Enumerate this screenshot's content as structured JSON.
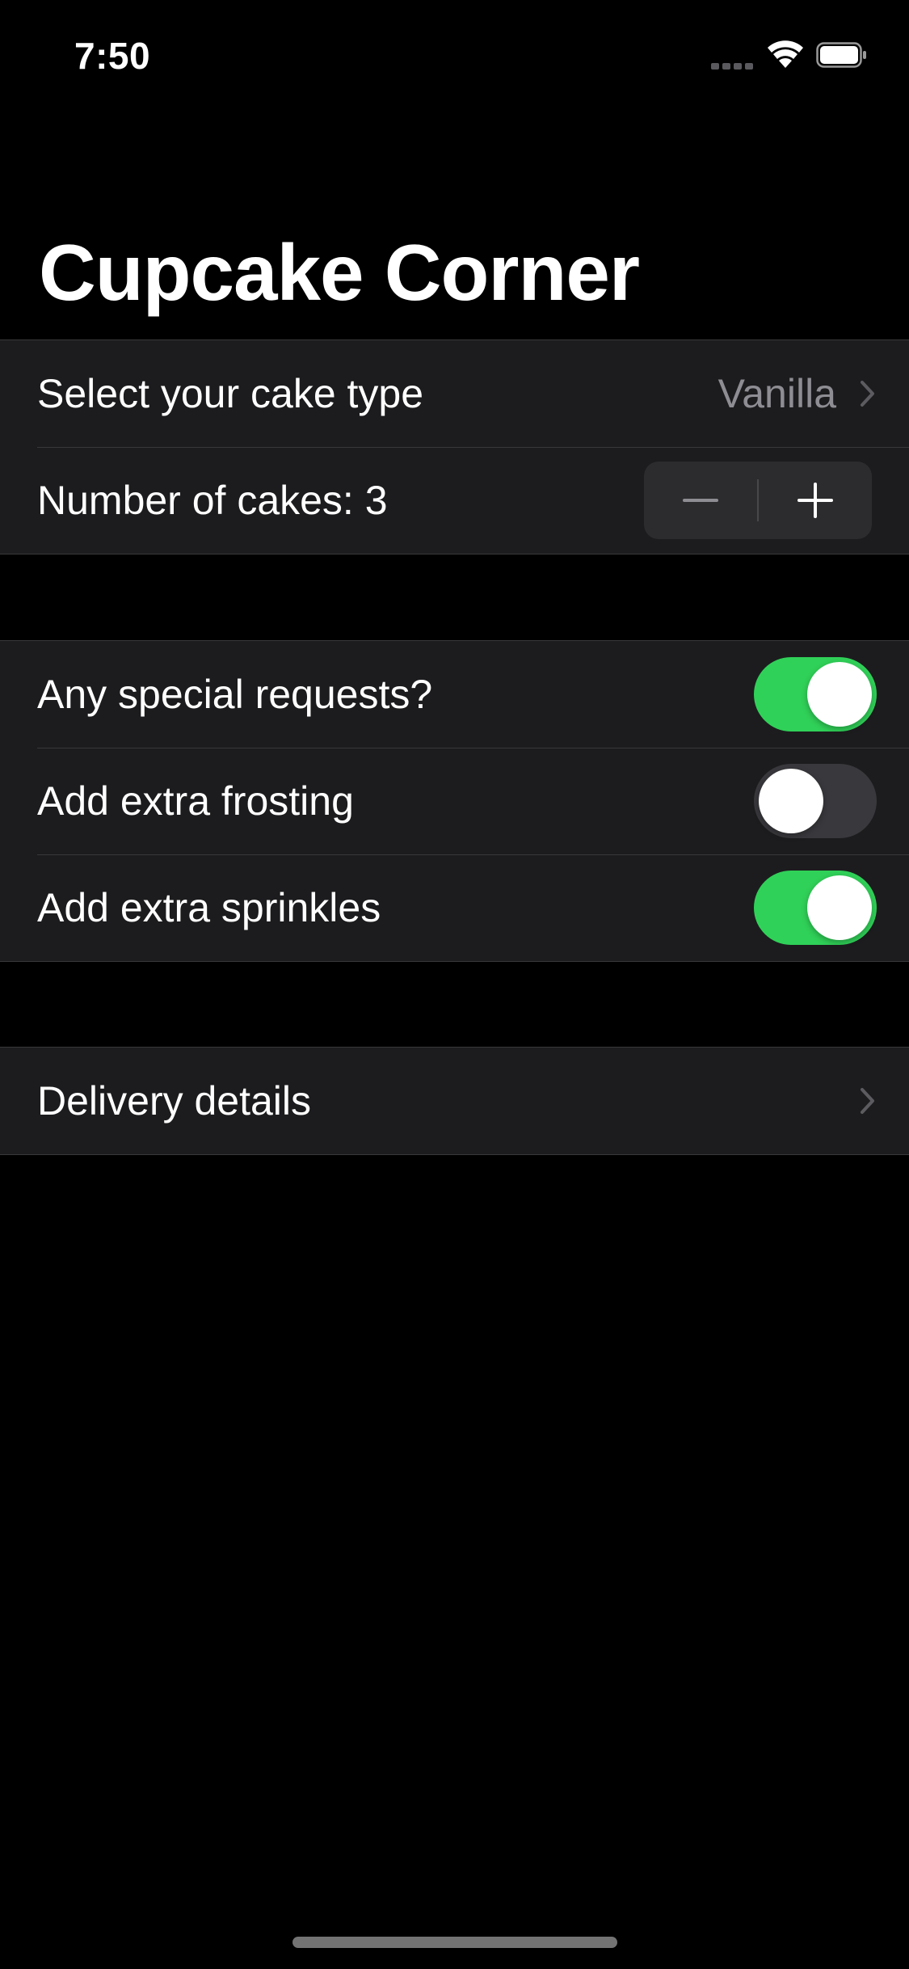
{
  "status_bar": {
    "time": "7:50",
    "icons": [
      "cellular-signal-icon",
      "wifi-icon",
      "battery-icon"
    ]
  },
  "title": "Cupcake Corner",
  "order_section": {
    "cake_type_label": "Select your cake type",
    "cake_type_value": "Vanilla",
    "quantity_label": "Number of cakes: 3",
    "quantity_value": 3
  },
  "special_section": {
    "special_requests_label": "Any special requests?",
    "special_requests_on": true,
    "extra_frosting_label": "Add extra frosting",
    "extra_frosting_on": false,
    "extra_sprinkles_label": "Add extra sprinkles",
    "extra_sprinkles_on": true
  },
  "delivery_section": {
    "delivery_label": "Delivery details"
  },
  "colors": {
    "background": "#000000",
    "cell": "#1c1c1e",
    "toggle_on": "#30d158",
    "toggle_off": "#39393d",
    "secondary_text": "#8d8d93"
  }
}
